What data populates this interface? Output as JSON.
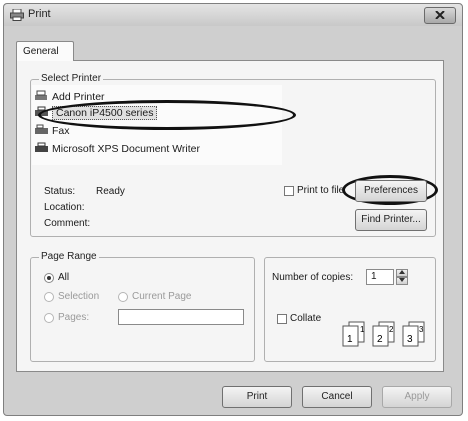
{
  "window": {
    "title": "Print",
    "close_icon": "close-icon"
  },
  "tabs": [
    {
      "label": "General"
    }
  ],
  "select_printer": {
    "legend": "Select Printer",
    "printers": [
      {
        "label": "Add Printer",
        "icon": "add-printer-icon"
      },
      {
        "label": "Canon iP4500 series",
        "icon": "printer-icon",
        "selected": true
      },
      {
        "label": "Fax",
        "icon": "fax-icon"
      },
      {
        "label": "Microsoft XPS Document Writer",
        "icon": "printer-icon"
      }
    ],
    "status_label": "Status:",
    "status_value": "Ready",
    "location_label": "Location:",
    "comment_label": "Comment:",
    "print_to_file_label": "Print to file",
    "preferences_button": "Preferences",
    "find_printer_button": "Find Printer..."
  },
  "page_range": {
    "legend": "Page Range",
    "all_label": "All",
    "selection_label": "Selection",
    "current_page_label": "Current Page",
    "pages_label": "Pages:",
    "pages_value": ""
  },
  "copies": {
    "number_label": "Number of copies:",
    "number_value": "1",
    "collate_label": "Collate",
    "collate_pages": [
      "1",
      "1",
      "2",
      "2",
      "3",
      "3"
    ]
  },
  "buttons": {
    "print": "Print",
    "cancel": "Cancel",
    "apply": "Apply"
  }
}
